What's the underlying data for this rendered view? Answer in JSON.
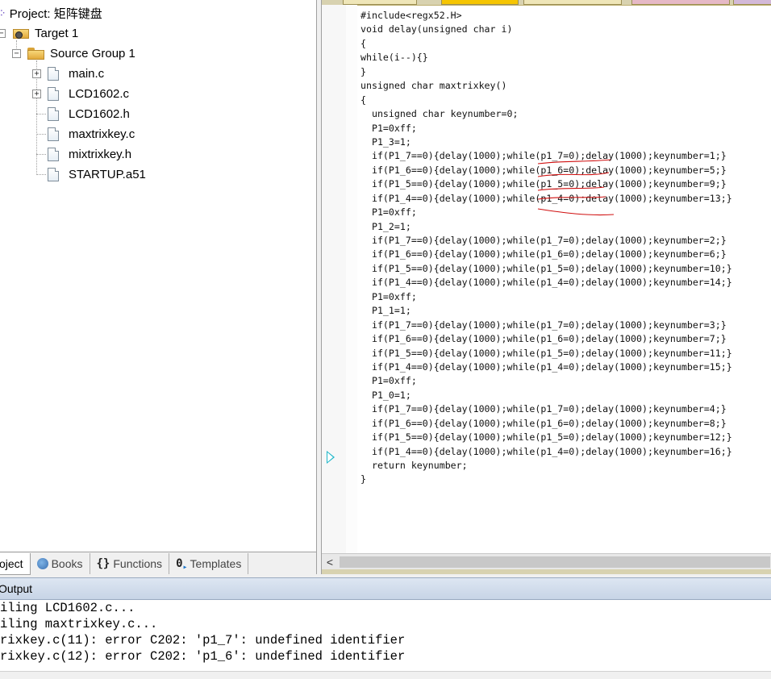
{
  "project": {
    "title": "Project: 矩阵键盘",
    "target": "Target 1",
    "group": "Source Group 1",
    "files": [
      "main.c",
      "LCD1602.c",
      "LCD1602.h",
      "maxtrixkey.c",
      "mixtrixkey.h",
      "STARTUP.a51"
    ]
  },
  "project_tabs": [
    {
      "label": "oject",
      "icon": "project-icon"
    },
    {
      "label": "Books",
      "icon": "books-icon"
    },
    {
      "label": "Functions",
      "icon": "braces-icon"
    },
    {
      "label": "Templates",
      "icon": "templates-icon"
    }
  ],
  "editor": {
    "code": [
      "#include<regx52.H>",
      "void delay(unsigned char i)",
      "{",
      "while(i--){}",
      "}",
      "unsigned char maxtrixkey()",
      "{",
      "  unsigned char keynumber=0;",
      "  P1=0xff;",
      "  P1_3=1;",
      "  if(P1_7==0){delay(1000);while(p1_7=0);delay(1000);keynumber=1;}",
      "  if(P1_6==0){delay(1000);while(p1_6=0);delay(1000);keynumber=5;}",
      "  if(P1_5==0){delay(1000);while(p1_5=0);delay(1000);keynumber=9;}",
      "  if(P1_4==0){delay(1000);while(p1_4=0);delay(1000);keynumber=13;}",
      "  P1=0xff;",
      "  P1_2=1;",
      "  if(P1_7==0){delay(1000);while(p1_7=0);delay(1000);keynumber=2;}",
      "  if(P1_6==0){delay(1000);while(p1_6=0);delay(1000);keynumber=6;}",
      "  if(P1_5==0){delay(1000);while(p1_5=0);delay(1000);keynumber=10;}",
      "  if(P1_4==0){delay(1000);while(p1_4=0);delay(1000);keynumber=14;}",
      "  P1=0xff;",
      "  P1_1=1;",
      "  if(P1_7==0){delay(1000);while(p1_7=0);delay(1000);keynumber=3;}",
      "  if(P1_6==0){delay(1000);while(p1_6=0);delay(1000);keynumber=7;}",
      "  if(P1_5==0){delay(1000);while(p1_5=0);delay(1000);keynumber=11;}",
      "  if(P1_4==0){delay(1000);while(p1_4=0);delay(1000);keynumber=15;}",
      "  P1=0xff;",
      "  P1_0=1;",
      "  if(P1_7==0){delay(1000);while(p1_7=0);delay(1000);keynumber=4;}",
      "  if(P1_6==0){delay(1000);while(p1_6=0);delay(1000);keynumber=8;}",
      "  if(P1_5==0){delay(1000);while(p1_5=0);delay(1000);keynumber=12;}",
      "  if(P1_4==0){delay(1000);while(p1_4=0);delay(1000);keynumber=16;}",
      "  return keynumber;",
      "}"
    ],
    "scroll_left": "<",
    "squiggle_color": "#d01010",
    "exec_marker_color": "#1fb7c9"
  },
  "output": {
    "title": "Output",
    "lines": [
      "iling LCD1602.c...",
      "iling maxtrixkey.c...",
      "rixkey.c(11): error C202: 'p1_7': undefined identifier",
      "rixkey.c(12): error C202: 'p1_6': undefined identifier"
    ]
  }
}
